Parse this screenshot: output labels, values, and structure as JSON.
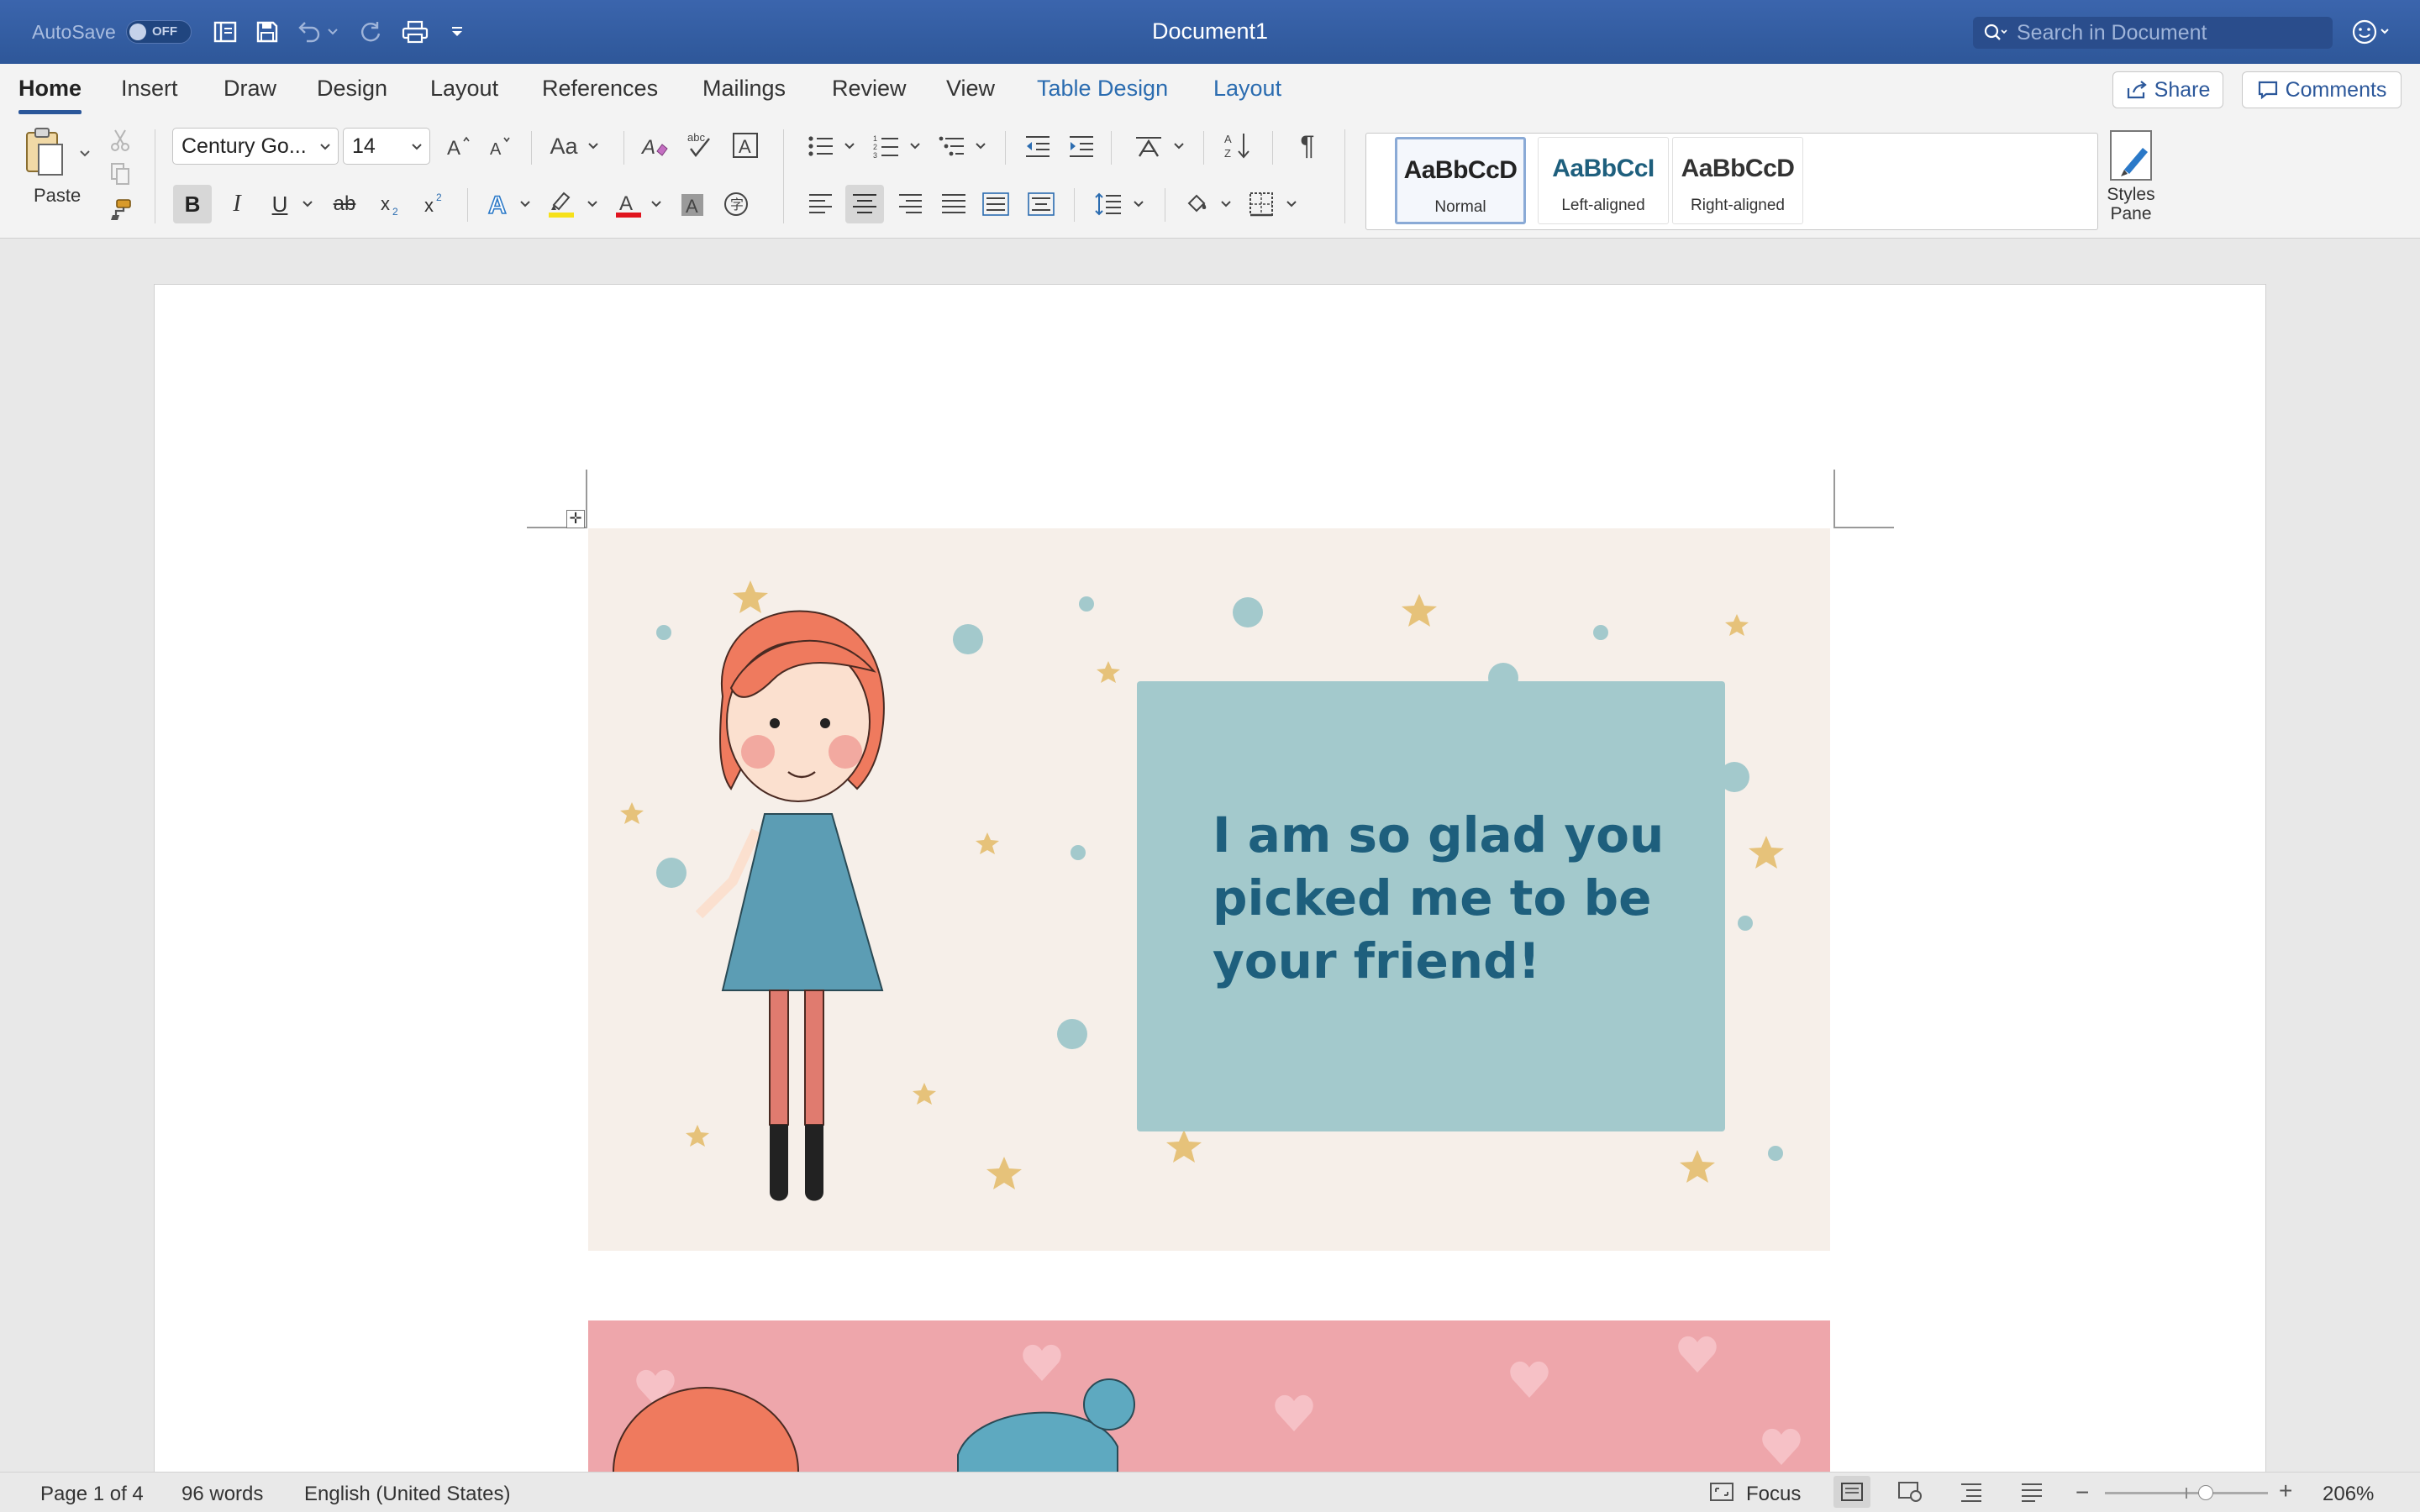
{
  "titlebar": {
    "autosave_label": "AutoSave",
    "autosave_state": "OFF",
    "title": "Document1",
    "search_placeholder": "Search in Document"
  },
  "tabs": [
    {
      "label": "Home"
    },
    {
      "label": "Insert"
    },
    {
      "label": "Draw"
    },
    {
      "label": "Design"
    },
    {
      "label": "Layout"
    },
    {
      "label": "References"
    },
    {
      "label": "Mailings"
    },
    {
      "label": "Review"
    },
    {
      "label": "View"
    },
    {
      "label": "Table Design"
    },
    {
      "label": "Layout"
    }
  ],
  "share_label": "Share",
  "comments_label": "Comments",
  "ribbon": {
    "paste_label": "Paste",
    "font_name": "Century Go...",
    "font_size": "14",
    "change_case": "Aa",
    "styles": [
      {
        "preview": "AaBbCcD",
        "name": "Normal",
        "color": "#111111"
      },
      {
        "preview": "AaBbCcI",
        "name": "Left-aligned",
        "color": "#1e5f7d"
      },
      {
        "preview": "AaBbCcD",
        "name": "Right-aligned",
        "color": "#333333"
      }
    ],
    "styles_pane_label": "Styles Pane"
  },
  "document": {
    "card_message": "I am so glad you picked me to be your friend!",
    "card_bg": "#f6efe9",
    "text_box_color": "#a3c9cc",
    "text_color": "#1e5f7d"
  },
  "status": {
    "page": "Page 1 of 4",
    "words": "96 words",
    "language": "English (United States)",
    "focus_label": "Focus",
    "zoom": "206%",
    "zoom_fraction": 0.62
  }
}
